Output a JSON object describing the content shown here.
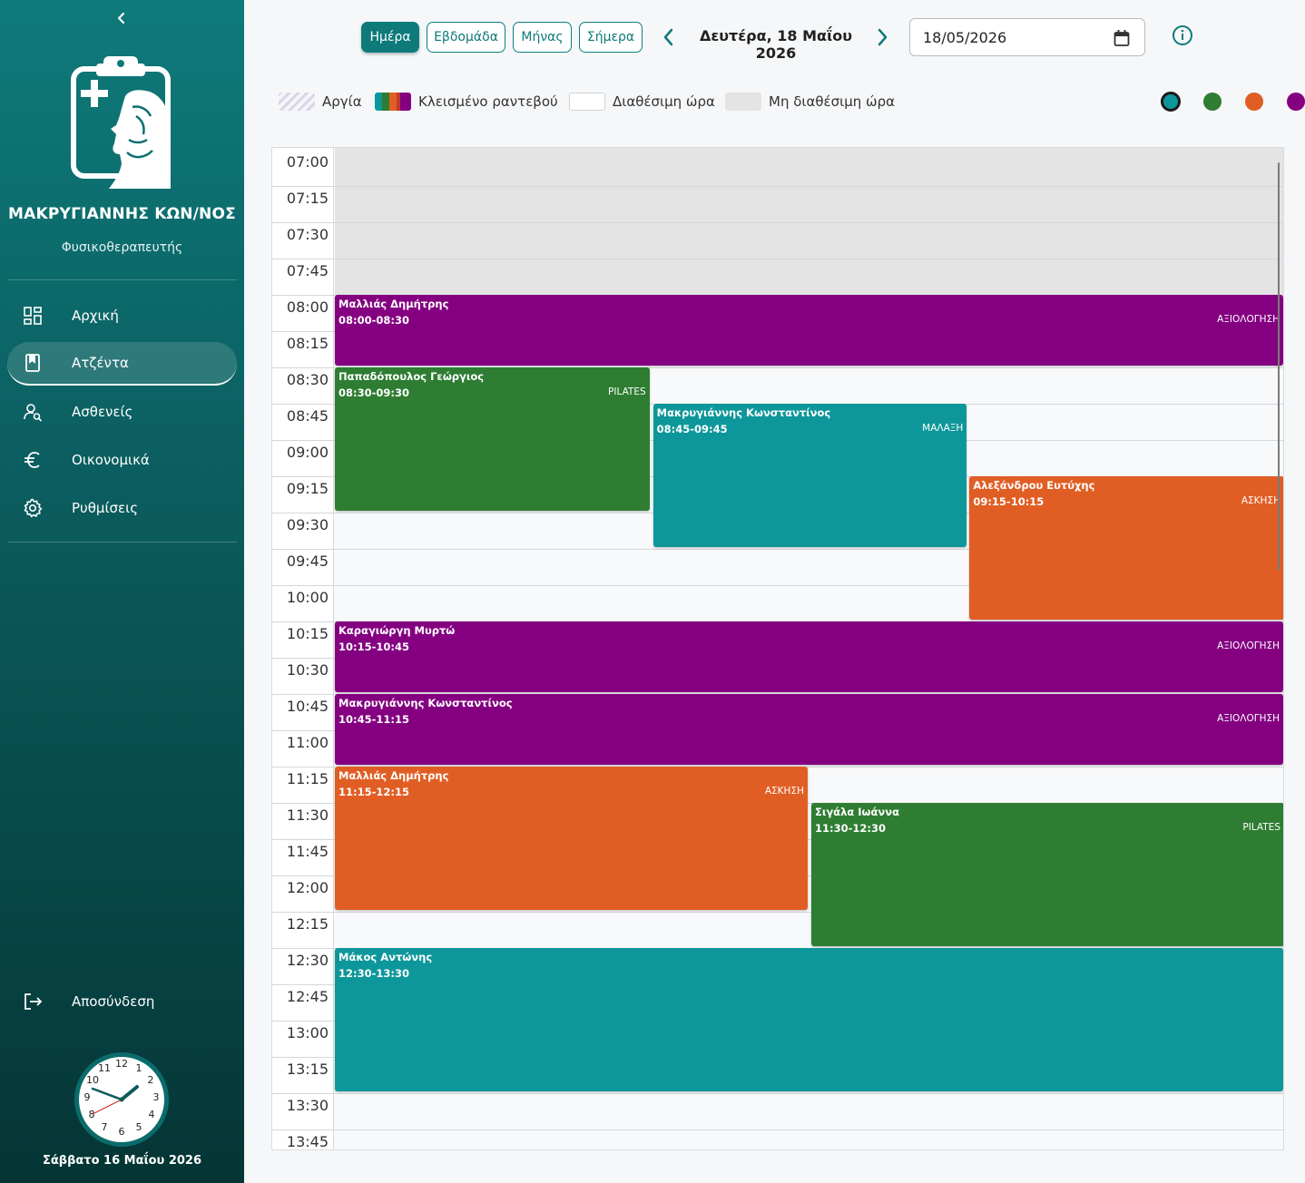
{
  "sidebar": {
    "user_name": "ΜΑΚΡΥΓΙΑΝΝΗΣ ΚΩΝ/ΝΟΣ",
    "user_role": "Φυσικοθεραπευτής",
    "items": [
      {
        "label": "Αρχική",
        "icon": "dashboard-icon"
      },
      {
        "label": "Ατζέντα",
        "icon": "book-icon"
      },
      {
        "label": "Ασθενείς",
        "icon": "patient-search-icon"
      },
      {
        "label": "Οικονομικά",
        "icon": "euro-icon"
      },
      {
        "label": "Ρυθμίσεις",
        "icon": "gear-icon"
      }
    ],
    "logout_label": "Αποσύνδεση",
    "clock_date": "Σάββατο 16 Μαΐου 2026"
  },
  "toolbar": {
    "views": [
      "Ημέρα",
      "Εβδομάδα",
      "Μήνας",
      "Σήμερα"
    ],
    "active_view": "Ημέρα",
    "date_title": "Δευτέρα, 18 Μαΐου 2026",
    "date_value": "18/05/2026"
  },
  "legend": {
    "holiday": "Αργία",
    "booked": "Κλεισμένο ραντεβού",
    "available": "Διαθέσιμη ώρα",
    "unavailable": "Μη διαθέσιμη ώρα"
  },
  "colors": {
    "teal": "#0e979a",
    "green": "#2e7d32",
    "orange": "#e05e24",
    "purple": "#840081",
    "unavailable": "#e4e4e4"
  },
  "calendar": {
    "times": [
      "07:00",
      "07:15",
      "07:30",
      "07:45",
      "08:00",
      "08:15",
      "08:30",
      "08:45",
      "09:00",
      "09:15",
      "09:30",
      "09:45",
      "10:00",
      "10:15",
      "10:30",
      "10:45",
      "11:00",
      "11:15",
      "11:30",
      "11:45",
      "12:00",
      "12:15",
      "12:30",
      "12:45",
      "13:00",
      "13:15",
      "13:30",
      "13:45"
    ],
    "events": [
      {
        "name": "Μαλλιάς Δημήτρης",
        "time": "08:00-08:30",
        "type": "ΑΞΙΟΛΟΓΗΣΗ",
        "color": "purple"
      },
      {
        "name": "Παπαδόπουλος Γεώργιος",
        "time": "08:30-09:30",
        "type": "PILATES",
        "color": "green"
      },
      {
        "name": "Μακρυγιάννης Κωνσταντίνος",
        "time": "08:45-09:45",
        "type": "ΜΑΛΑΞΗ",
        "color": "teal"
      },
      {
        "name": "Αλεξάνδρου Ευτύχης",
        "time": "09:15-10:15",
        "type": "ΑΣΚΗΣΗ",
        "color": "orange"
      },
      {
        "name": "Καραγιώργη Μυρτώ",
        "time": "10:15-10:45",
        "type": "ΑΞΙΟΛΟΓΗΣΗ",
        "color": "purple"
      },
      {
        "name": "Μακρυγιάννης Κωνσταντίνος",
        "time": "10:45-11:15",
        "type": "ΑΞΙΟΛΟΓΗΣΗ",
        "color": "purple"
      },
      {
        "name": "Μαλλιάς Δημήτρης",
        "time": "11:15-12:15",
        "type": "ΑΣΚΗΣΗ",
        "color": "orange"
      },
      {
        "name": "Σιγάλα Ιωάννα",
        "time": "11:30-12:30",
        "type": "PILATES",
        "color": "green"
      },
      {
        "name": "Μάκος Αντώνης",
        "time": "12:30-13:30",
        "type": "",
        "color": "teal"
      }
    ]
  }
}
